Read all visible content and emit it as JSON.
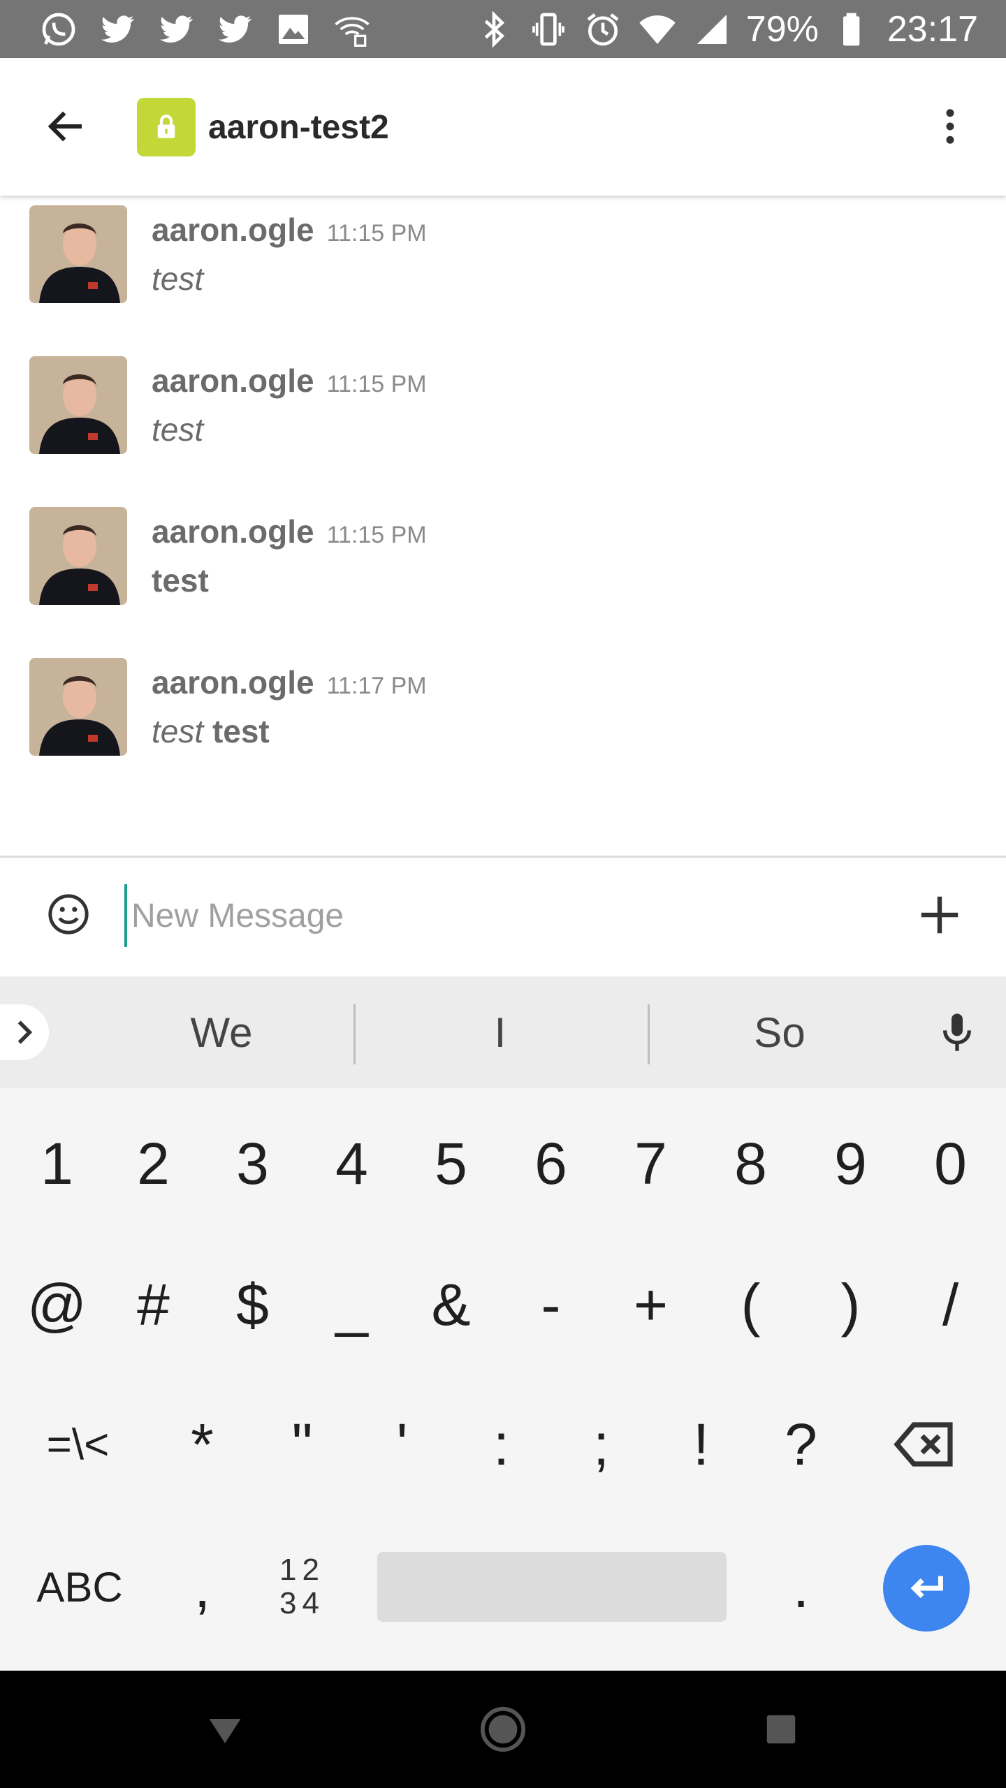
{
  "status_bar": {
    "battery_percent": "79%",
    "time": "23:17",
    "left_icons": [
      "whatsapp-icon",
      "twitter-icon",
      "twitter-icon",
      "twitter-icon",
      "image-icon",
      "wifi-notification-icon"
    ],
    "right_icons": [
      "bluetooth-icon",
      "vibrate-icon",
      "alarm-icon",
      "wifi-icon",
      "signal-icon",
      "battery-icon"
    ]
  },
  "header": {
    "channel_name": "aaron-test2",
    "channel_icon": "lock-icon",
    "accent_color": "#c3d837"
  },
  "messages": [
    {
      "user": "aaron.ogle",
      "time": "11:15 PM",
      "segments": [
        {
          "text": "test",
          "style": "italic"
        }
      ]
    },
    {
      "user": "aaron.ogle",
      "time": "11:15 PM",
      "segments": [
        {
          "text": "test",
          "style": "italic"
        }
      ]
    },
    {
      "user": "aaron.ogle",
      "time": "11:15 PM",
      "segments": [
        {
          "text": "test",
          "style": "bold"
        }
      ]
    },
    {
      "user": "aaron.ogle",
      "time": "11:17 PM",
      "segments": [
        {
          "text": "test",
          "style": "italic"
        },
        {
          "text": " ",
          "style": "normal"
        },
        {
          "text": "test",
          "style": "bold"
        }
      ]
    }
  ],
  "composer": {
    "placeholder": "New Message",
    "value": ""
  },
  "keyboard": {
    "suggestions": [
      "We",
      "I",
      "So"
    ],
    "row1": [
      "1",
      "2",
      "3",
      "4",
      "5",
      "6",
      "7",
      "8",
      "9",
      "0"
    ],
    "row2": [
      "@",
      "#",
      "$",
      "_",
      "&",
      "-",
      "+",
      "(",
      ")",
      "/"
    ],
    "row3": [
      "=\\<",
      "*",
      "\"",
      "'",
      ":",
      ";",
      "!",
      "?"
    ],
    "abc_label": "ABC",
    "comma": ",",
    "numpad_top": "12",
    "numpad_bottom": "34",
    "period": ".",
    "enter_color": "#3d86f0"
  }
}
